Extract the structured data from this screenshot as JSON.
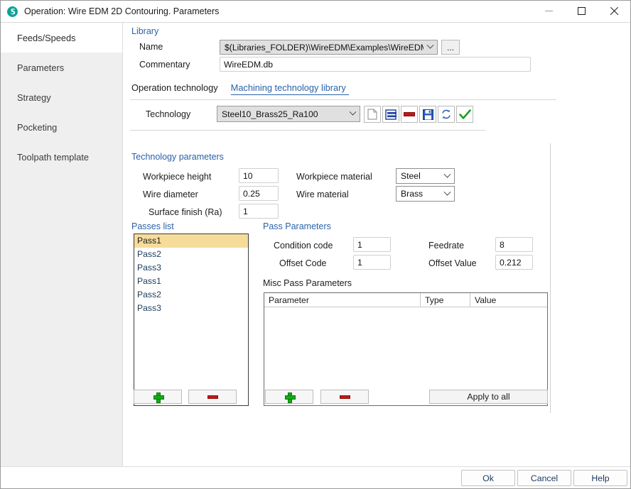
{
  "window": {
    "title": "Operation: Wire EDM 2D Contouring. Parameters",
    "app_icon": "swirl-logo-icon",
    "controls": {
      "minimize": "minimize-icon",
      "maximize": "maximize-icon",
      "close": "close-icon"
    }
  },
  "sidebar": {
    "items": [
      {
        "label": "Feeds/Speeds",
        "active": true
      },
      {
        "label": "Parameters",
        "active": false
      },
      {
        "label": "Strategy",
        "active": false
      },
      {
        "label": "Pocketing",
        "active": false
      },
      {
        "label": "Toolpath template",
        "active": false
      }
    ]
  },
  "library": {
    "group_label": "Library",
    "name_label": "Name",
    "name_value": "$(Libraries_FOLDER)\\WireEDM\\Examples\\WireEDM.db",
    "browse_label": "...",
    "commentary_label": "Commentary",
    "commentary_value": "WireEDM.db"
  },
  "tabs": [
    {
      "label": "Operation technology",
      "selected": false
    },
    {
      "label": "Machining technology library",
      "selected": true
    }
  ],
  "technology": {
    "label": "Technology",
    "value": "Steel10_Brass25_Ra100",
    "toolbar": [
      {
        "name": "new-document-icon",
        "title": "New"
      },
      {
        "name": "add-record-icon",
        "title": "Add"
      },
      {
        "name": "delete-record-icon",
        "title": "Delete"
      },
      {
        "name": "save-icon",
        "title": "Save"
      },
      {
        "name": "refresh-icon",
        "title": "Refresh"
      },
      {
        "name": "apply-check-icon",
        "title": "Apply"
      }
    ]
  },
  "technology_parameters": {
    "group_label": "Technology parameters",
    "workpiece_height_label": "Workpiece height",
    "workpiece_height_value": "10",
    "wire_diameter_label": "Wire diameter",
    "wire_diameter_value": "0.25",
    "surface_finish_label": "Surface finish (Ra)",
    "surface_finish_value": "1",
    "workpiece_material_label": "Workpiece material",
    "workpiece_material_value": "Steel",
    "wire_material_label": "Wire material",
    "wire_material_value": "Brass"
  },
  "passes": {
    "group_label": "Passes list",
    "items": [
      {
        "label": "Pass1",
        "selected": true
      },
      {
        "label": "Pass2",
        "selected": false
      },
      {
        "label": "Pass3",
        "selected": false
      },
      {
        "label": "Pass1",
        "selected": false
      },
      {
        "label": "Pass2",
        "selected": false
      },
      {
        "label": "Pass3",
        "selected": false
      }
    ],
    "add_label": "+",
    "remove_label": "-"
  },
  "pass_parameters": {
    "group_label": "Pass Parameters",
    "condition_code_label": "Condition code",
    "condition_code_value": "1",
    "offset_code_label": "Offset Code",
    "offset_code_value": "1",
    "feedrate_label": "Feedrate",
    "feedrate_value": "8",
    "offset_value_label": "Offset Value",
    "offset_value_value": "0.212"
  },
  "misc_pass_parameters": {
    "group_label": "Misc Pass Parameters",
    "columns": [
      "Parameter",
      "Type",
      "Value"
    ],
    "rows": [],
    "add_label": "+",
    "remove_label": "-",
    "apply_to_all_label": "Apply to all"
  },
  "footer": {
    "ok_label": "Ok",
    "cancel_label": "Cancel",
    "help_label": "Help"
  },
  "colors": {
    "accent_blue": "#2a62a8",
    "selection_amber": "#f6dc9a",
    "sidebar_bg": "#efefef",
    "green": "#18a818",
    "red": "#c41717"
  }
}
